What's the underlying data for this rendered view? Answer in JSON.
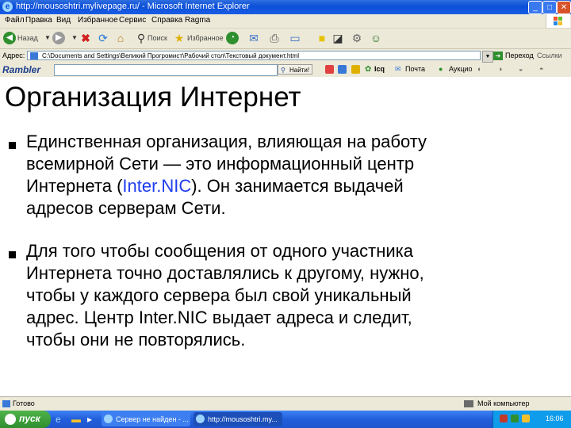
{
  "window": {
    "title": "http://mousoshtri.mylivepage.ru/ - Microsoft Internet Explorer"
  },
  "menu": [
    "Файл",
    "Правка",
    "Вид",
    "Избранное",
    "Сервис",
    "Справка",
    "Ragma"
  ],
  "toolbar": {
    "back_label": "Назад",
    "search_label": "Поиск",
    "favorites_label": "Избранное"
  },
  "address_bar": {
    "label": "Адрес:",
    "value": "C:\\Documents and Settings\\Великий Прогромист\\Рабочий стол\\Текстовый документ.html",
    "go_label": "Переход",
    "links_label": "Ссылки"
  },
  "rambler_bar": {
    "logo": "Rambler",
    "find_label": "Найти!",
    "icq_label": "Icq",
    "mail_label": "Почта",
    "search2_label": "Аукцио"
  },
  "content": {
    "heading": "Организация Интернет",
    "bullets": [
      {
        "line1": "Единственная организация, влияющая на работу",
        "line2": "всемирной Сети — это информационный центр",
        "line3_before": "Интернета (",
        "line3_link": "Inter.NIC",
        "line3_after": "). Он занимается выдачей",
        "line4": "адресов серверам Сети."
      },
      {
        "line1": "Для того чтобы сообщения от одного участника",
        "line2": "Интернета точно доставлялись к другому, нужно,",
        "line3": "чтобы у каждого сервера был свой уникальный",
        "line4": "адрес. Центр Inter.NIC выдает адреса и следит,",
        "line5": "чтобы они не повторялись."
      }
    ]
  },
  "status_bar": {
    "text": "Готово",
    "zone": "Мой компьютер"
  },
  "taskbar": {
    "start_label": "пуск",
    "tasks": [
      "Сервер не найден - ...",
      "http://mousoshtri.my..."
    ],
    "clock": "16:06"
  },
  "colors": {
    "titlebar": "#0b4fd8",
    "chrome": "#ece9d8",
    "link": "#1e3cf0",
    "start_button": "#3c9e3a"
  }
}
